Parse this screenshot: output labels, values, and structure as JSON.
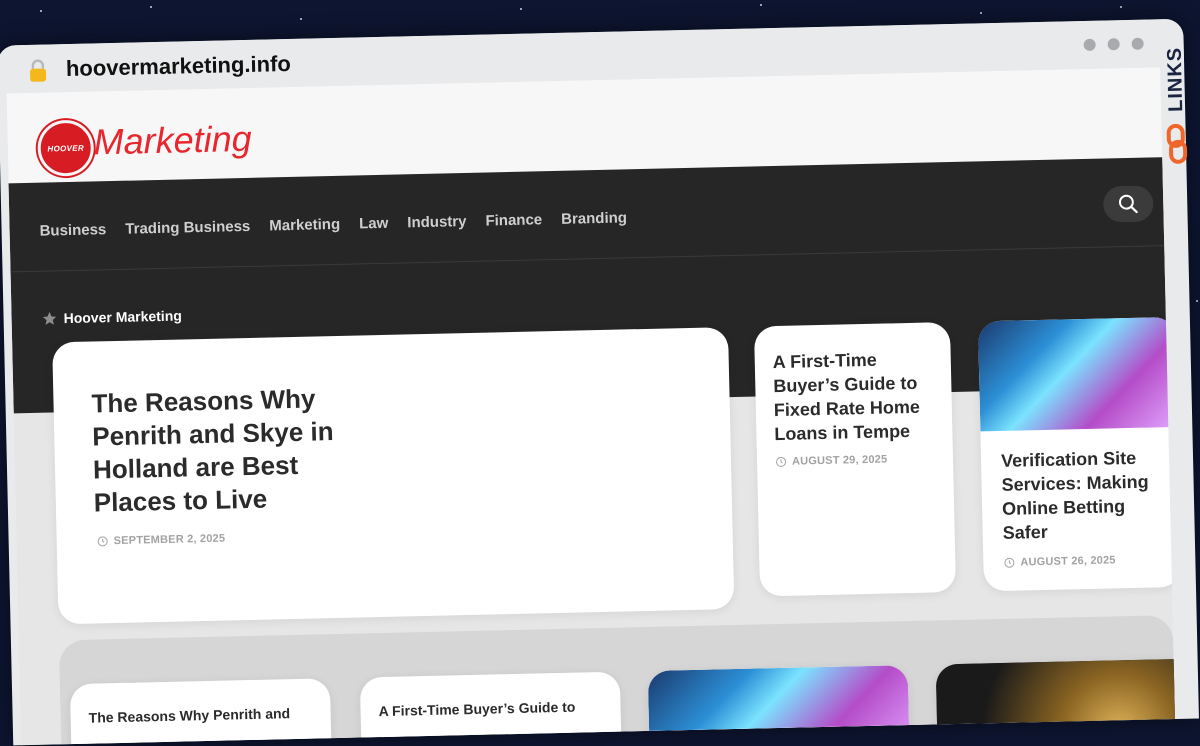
{
  "browser": {
    "url": "hoovermarketing.info"
  },
  "site": {
    "logo_badge": "HOOVER",
    "logo_text": "Marketing"
  },
  "nav": {
    "items": [
      "Business",
      "Trading Business",
      "Marketing",
      "Law",
      "Industry",
      "Finance",
      "Branding"
    ]
  },
  "breadcrumb": {
    "label": "Hoover Marketing"
  },
  "posts": [
    {
      "title": "The Reasons Why Penrith and Skye in Holland are Best Places to Live",
      "date": "SEPTEMBER 2, 2025"
    },
    {
      "title": "A First-Time Buyer’s Guide to Fixed Rate Home Loans in Tempe",
      "date": "AUGUST 29, 2025"
    },
    {
      "title": "Verification Site Services: Making Online Betting Safer",
      "date": "AUGUST 26, 2025"
    }
  ],
  "lower_posts": [
    {
      "title": "The Reasons Why Penrith and"
    },
    {
      "title": "A First-Time Buyer’s Guide to"
    }
  ],
  "side_badge": {
    "text": "LINKS"
  },
  "colors": {
    "brand_red": "#e8262d",
    "header_dark": "#262626",
    "card_bg": "#ffffff"
  }
}
